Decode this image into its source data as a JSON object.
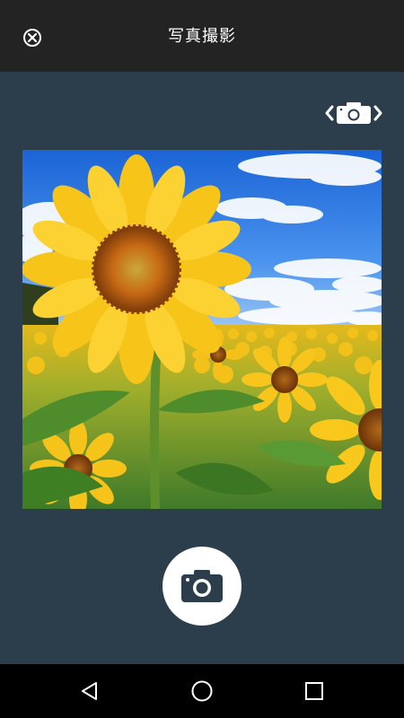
{
  "header": {
    "title": "写真撮影",
    "close_icon": "close-circle-icon"
  },
  "camera": {
    "switch_icon": "switch-camera-icon",
    "shutter_icon": "camera-icon",
    "preview_subject": "sunflower-field-photo"
  },
  "navigation": {
    "back_icon": "triangle-back-icon",
    "home_icon": "circle-home-icon",
    "recents_icon": "square-recents-icon"
  },
  "colors": {
    "top_bar": "#232323",
    "background": "#2c3e4b",
    "nav_bar": "#000000",
    "shutter_bg": "#ffffff",
    "icon_dark": "#2c3e4b"
  }
}
